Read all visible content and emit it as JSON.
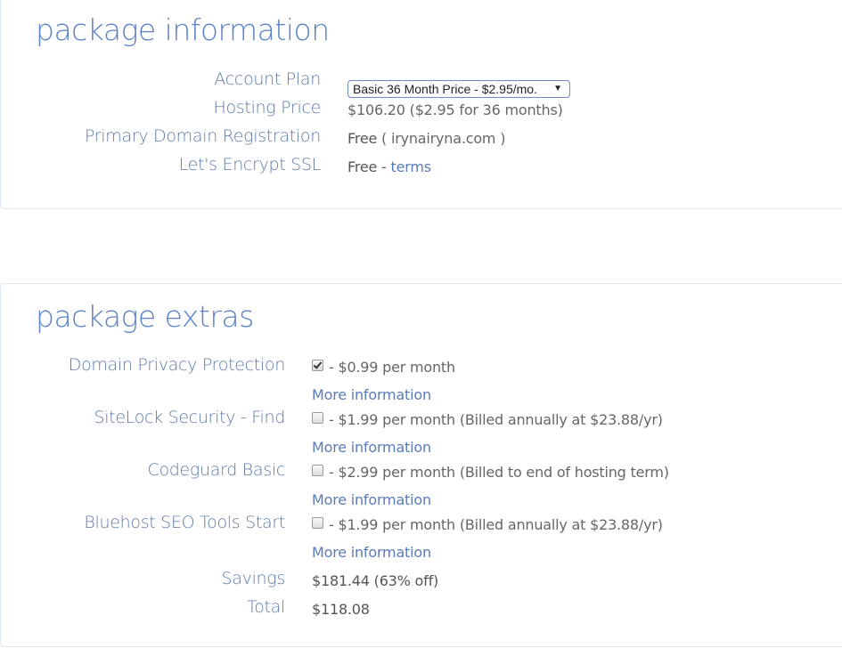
{
  "package_information": {
    "title": "package information",
    "rows": {
      "account_plan": {
        "label": "Account Plan",
        "selected_option": "Basic 36 Month Price - $2.95/mo.",
        "arrow": "▼"
      },
      "hosting_price": {
        "label": "Hosting Price",
        "value": "$106.20  ($2.95 for 36 months)"
      },
      "domain_registration": {
        "label": "Primary Domain Registration",
        "value_strong": "Free",
        "value_rest": " ( irynairyna.com )"
      },
      "ssl": {
        "label": "Let's Encrypt SSL",
        "value_strong": "Free",
        "separator": " - ",
        "link": "terms"
      }
    }
  },
  "package_extras": {
    "title": "package extras",
    "items": [
      {
        "label": "Domain Privacy Protection",
        "checked": true,
        "price": "- $0.99 per month",
        "more_info": "More information"
      },
      {
        "label": "SiteLock Security - Find",
        "checked": false,
        "price": "- $1.99 per month (Billed annually at $23.88/yr)",
        "more_info": "More information"
      },
      {
        "label": "Codeguard Basic",
        "checked": false,
        "price": "- $2.99 per month (Billed to end of hosting term)",
        "more_info": "More information"
      },
      {
        "label": "Bluehost SEO Tools Start",
        "checked": false,
        "price": "- $1.99 per month (Billed annually at $23.88/yr)",
        "more_info": "More information"
      }
    ],
    "savings": {
      "label": "Savings",
      "value": "$181.44 (63% off)"
    },
    "total": {
      "label": "Total",
      "value": "$118.08"
    }
  },
  "colors": {
    "title": "#5a80c8",
    "label": "#5d7ba8",
    "link": "#5a7bb8",
    "value": "#666666",
    "border": "#dfe7ef"
  }
}
